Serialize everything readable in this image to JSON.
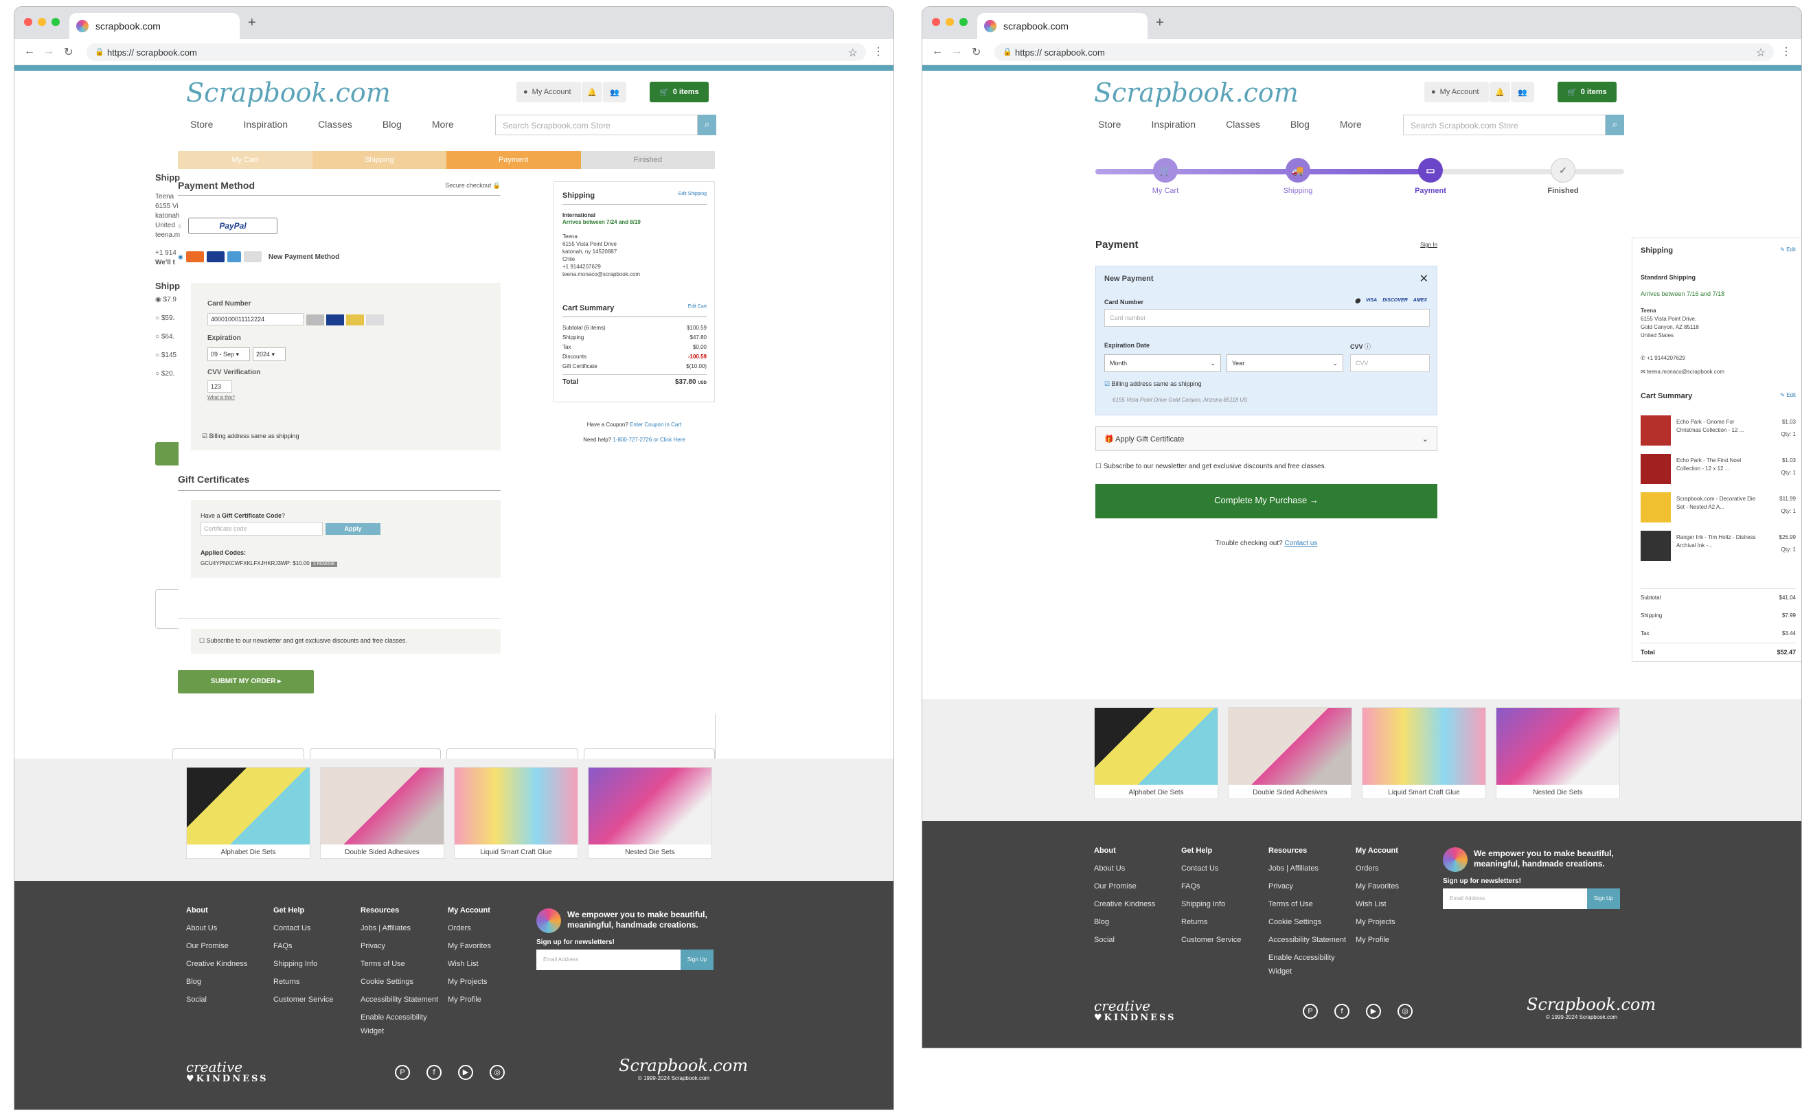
{
  "browser": {
    "tab_title": "scrapbook.com",
    "url_prefix": "https://",
    "url": "scrapbook.com"
  },
  "header": {
    "logo": "Scrapbook.com",
    "my_account": "My Account",
    "cart": "0 items",
    "nav": [
      "Store",
      "Inspiration",
      "Classes",
      "Blog",
      "More"
    ],
    "search_placeholder": "Search Scrapbook.com Store"
  },
  "old": {
    "steps": [
      "My Cart",
      "Shipping",
      "Payment",
      "Finished"
    ],
    "payment_method": "Payment Method",
    "secure": "Secure checkout",
    "paypal": "PayPal",
    "new_payment": "New Payment Method",
    "card_number_label": "Card Number",
    "card_number": "4000100011112224",
    "expiration_label": "Expiration",
    "exp_month": "09 - Sep",
    "exp_year": "2024",
    "cvv_label": "CVV Verification",
    "cvv": "123",
    "whats_this": "What is this?",
    "billing_same": "Billing address same as shipping",
    "gift_title": "Gift Certificates",
    "gift_prompt_pre": "Have a ",
    "gift_prompt_bold": "Gift Certificate Code",
    "gift_prompt_post": "?",
    "gift_placeholder": "Certificate code",
    "apply": "Apply",
    "applied_codes": "Applied Codes:",
    "applied_code": "GCU4YPNXCWFXKLFXJHKRJ3WP: $10.00",
    "remove": "X REMOVE",
    "subscribe": "Subscribe to our newsletter and get exclusive discounts and free classes.",
    "submit": "SUBMIT MY ORDER ▸",
    "hidden_ship": "Shipp",
    "hidden_lines": [
      "Teena",
      "6155 Vi",
      "katonah",
      "United",
      "teena.m"
    ],
    "hidden_phone": "+1 914",
    "hidden_well": "We'll t",
    "hidden_rates": [
      "$7.9",
      "$59.",
      "$64.",
      "$145",
      "$20."
    ],
    "ship_title": "Shipping",
    "edit_shipping": "Edit Shipping",
    "intl": "International",
    "arrives": "Arrives between 7/24 and 8/19",
    "addr": [
      "Teena",
      "6155 Vista Point Drive",
      "katonah, ny 14520887",
      "Chile",
      "+1 9144207629",
      "teena.monaco@scrapbook.com"
    ],
    "cart_summary": "Cart Summary",
    "edit_cart": "Edit Cart",
    "summary": [
      [
        "Subtotal (6 items)",
        "$100.59"
      ],
      [
        "Shipping",
        "$47.80"
      ],
      [
        "Tax",
        "$0.00"
      ],
      [
        "Discounts",
        "-100.59"
      ],
      [
        "Gift Certificate",
        "$(10.00)"
      ]
    ],
    "total_label": "Total",
    "total": "$37.80",
    "currency": "USD",
    "coupon_pre": "Have a Coupon? ",
    "coupon_link": "Enter Coupon in Cart",
    "help_pre": "Need help? ",
    "help_link": "1-800-727-2726 or Click Here"
  },
  "new": {
    "steps": [
      "My Cart",
      "Shipping",
      "Payment",
      "Finished"
    ],
    "payment": "Payment",
    "sign_in": "Sign In",
    "new_payment": "New Payment",
    "card_number_label": "Card Number",
    "card_placeholder": "Card number",
    "card_brands": [
      "VISA",
      "DISCOVER",
      "AMEX"
    ],
    "exp_label": "Expiration Date",
    "cvv_label": "CVV",
    "month": "Month",
    "year": "Year",
    "cvv_placeholder": "CVV",
    "billing_same": "Billing address same as shipping",
    "billing_addr": "6155 Vista Point Drive Gold Canyon, Arizona 85118 US",
    "gift": "Apply Gift Certificate",
    "subscribe": "Subscribe to our newsletter and get exclusive discounts and free classes.",
    "complete": "Complete My Purchase",
    "trouble": "Trouble checking out?",
    "contact": "Contact us",
    "ship_title": "Shipping",
    "edit": "Edit",
    "std": "Standard Shipping",
    "arrives": "Arrives between 7/16 and 7/18",
    "addr": [
      "Teena",
      "6155 Vista Point Drive,",
      "Gold Canyon, AZ 85118",
      "United States"
    ],
    "phone": "+1 9144207629",
    "email": "teena.monaco@scrapbook.com",
    "cart_summary": "Cart Summary",
    "items": [
      {
        "name": "Echo Park - Gnome For Christmas Collection - 12 ...",
        "price": "$1.03",
        "qty": "Qty: 1",
        "color": "#b5302a"
      },
      {
        "name": "Echo Park - The First Noel Collection - 12 x 12 ...",
        "price": "$1.03",
        "qty": "Qty: 1",
        "color": "#a32020"
      },
      {
        "name": "Scrapbook.com - Decorative Die Set - Nested A2 A...",
        "price": "$11.99",
        "qty": "Qty: 1",
        "color": "#f0c030"
      },
      {
        "name": "Ranger Ink - Tim Holtz - Distress Archival Ink -...",
        "price": "$26.99",
        "qty": "Qty: 1",
        "color": "#333333"
      }
    ],
    "summary": [
      [
        "Subtotal",
        "$41.04"
      ],
      [
        "Shipping",
        "$7.99"
      ],
      [
        "Tax",
        "$3.44"
      ]
    ],
    "total_label": "Total",
    "total": "$52.47"
  },
  "promos": [
    "Alphabet Die Sets",
    "Double Sided Adhesives",
    "Liquid Smart Craft Glue",
    "Nested Die Sets"
  ],
  "footer": {
    "cols": [
      {
        "title": "About",
        "items": [
          "About Us",
          "Our Promise",
          "Creative Kindness",
          "Blog",
          "Social"
        ]
      },
      {
        "title": "Get Help",
        "items": [
          "Contact Us",
          "FAQs",
          "Shipping Info",
          "Returns",
          "Customer Service"
        ]
      },
      {
        "title": "Resources",
        "items": [
          "Jobs | Affiliates",
          "Privacy",
          "Terms of Use",
          "Cookie Settings",
          "Accessibility Statement",
          "Enable Accessibility",
          "Widget"
        ]
      },
      {
        "title": "My Account",
        "items": [
          "Orders",
          "My Favorites",
          "Wish List",
          "My Projects",
          "My Profile"
        ]
      }
    ],
    "tagline": "We empower you to make beautiful, meaningful, handmade creations.",
    "signup": "Sign up for newsletters!",
    "email_placeholder": "Email Address",
    "sign_up": "Sign Up",
    "ck1": "creative",
    "ck2": "♥KINDNESS",
    "logo": "Scrapbook.com",
    "copyright": "© 1999-2024 Scrapbook.com"
  }
}
